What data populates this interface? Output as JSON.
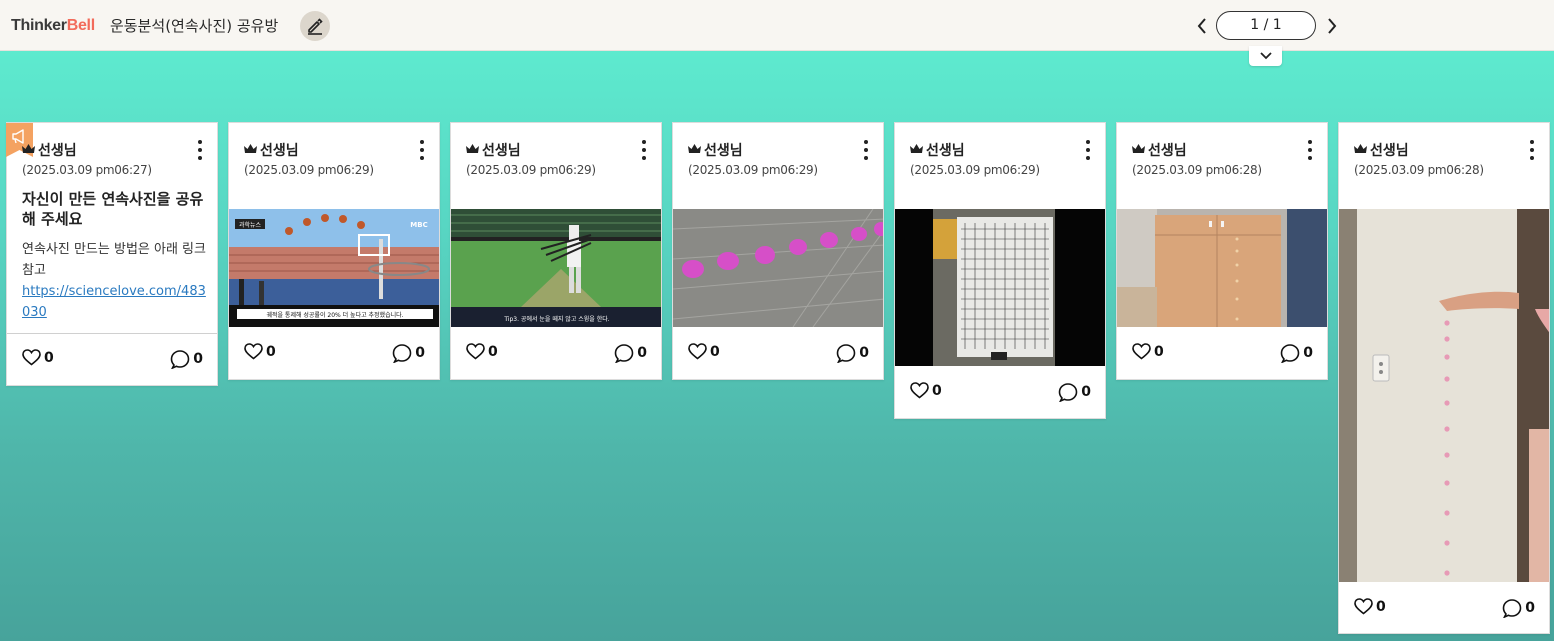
{
  "header": {
    "logo_part1": "Thinker",
    "logo_part2": "Bell",
    "board_title": "운동분석(연속사진) 공유방",
    "pager_text": "1 / 1",
    "edit_icon": "pencil-icon",
    "prev_icon": "chevron-left-icon",
    "next_icon": "chevron-right-icon",
    "collapse_icon": "chevron-down-icon"
  },
  "colors": {
    "accent": "#f26b5b",
    "notice_flag": "#f4a261",
    "link": "#2a7ac0",
    "background_top": "#5ff0d2",
    "background_bottom": "#47a39b"
  },
  "posts": [
    {
      "author": "선생님",
      "date": "(2025.03.09 pm06:27)",
      "notice": true,
      "title": "자신이 만든 연속사진을 공유해 주세요",
      "body": "연속사진 만드는 방법은 아래 링크 참고",
      "link": "https://sciencelove.com/483030",
      "likes": "0",
      "comments": "0"
    },
    {
      "author": "선생님",
      "date": "(2025.03.09 pm06:29)",
      "image": "basketball-sequence-photo",
      "image_caption_tag": "과학뉴스",
      "image_caption_logo": "MBC",
      "image_caption": "궤적을 통제해 성공률이 20% 더 높다고 추정했습니다.",
      "likes": "0",
      "comments": "0"
    },
    {
      "author": "선생님",
      "date": "(2025.03.09 pm06:29)",
      "image": "baseball-batting-sequence-photo",
      "image_caption": "Tip3. 공에서 눈을 떼지 않고 스윙을 한다.",
      "likes": "0",
      "comments": "0"
    },
    {
      "author": "선생님",
      "date": "(2025.03.09 pm06:29)",
      "image": "pink-ball-rolling-sequence-photo",
      "likes": "0",
      "comments": "0"
    },
    {
      "author": "선생님",
      "date": "(2025.03.09 pm06:29)",
      "image": "grid-board-sequence-photo",
      "likes": "0",
      "comments": "0"
    },
    {
      "author": "선생님",
      "date": "(2025.03.09 pm06:28)",
      "image": "falling-ball-cabinet-photo",
      "likes": "0",
      "comments": "0"
    },
    {
      "author": "선생님",
      "date": "(2025.03.09 pm06:28)",
      "image": "falling-ball-wall-photo",
      "likes": "0",
      "comments": "0"
    }
  ]
}
